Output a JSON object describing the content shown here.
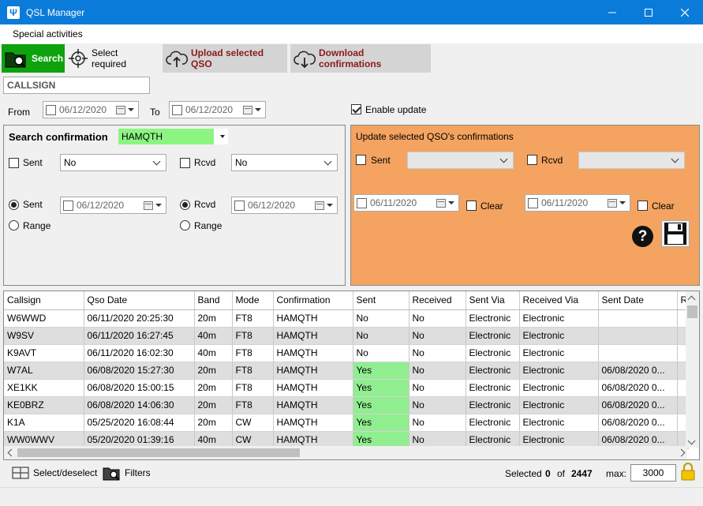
{
  "window": {
    "title": "QSL Manager",
    "app_icon": "antenna-icon"
  },
  "menu": {
    "items": [
      "Special activities"
    ]
  },
  "toolbar": {
    "search_label": "Search",
    "select_required_label": "Select required",
    "upload_label": "Upload selected QSO",
    "download_label": "Download confirmations"
  },
  "filters": {
    "callsign_value": "CALLSIGN",
    "from_label": "From",
    "from_date": "06/12/2020",
    "to_label": "To",
    "to_date": "06/12/2020",
    "enable_update_label": "Enable update",
    "enable_update_checked": true
  },
  "search_panel": {
    "title": "Search confirmation",
    "service": "HAMQTH",
    "sent_label": "Sent",
    "sent_value": "No",
    "rcvd_label": "Rcvd",
    "rcvd_value": "No",
    "sent_radio_label": "Sent",
    "sent_radio_date": "06/12/2020",
    "range_label": "Range",
    "rcvd_radio_label": "Rcvd",
    "rcvd_radio_date": "06/12/2020",
    "range2_label": "Range"
  },
  "update_panel": {
    "title": "Update selected QSO's confirmations",
    "sent_label": "Sent",
    "rcvd_label": "Rcvd",
    "sent_date": "06/11/2020",
    "clear_label": "Clear",
    "rcvd_date": "06/11/2020",
    "clear2_label": "Clear",
    "color": "#f4a460"
  },
  "grid": {
    "columns": [
      "Callsign",
      "Qso Date",
      "Band",
      "Mode",
      "Confirmation",
      "Sent",
      "Received",
      "Sent Via",
      "Received Via",
      "Sent Date",
      "R"
    ],
    "rows": [
      [
        "W6WWD",
        "06/11/2020 20:25:30",
        "20m",
        "FT8",
        "HAMQTH",
        "No",
        "No",
        "Electronic",
        "Electronic",
        "",
        ""
      ],
      [
        "W9SV",
        "06/11/2020 16:27:45",
        "40m",
        "FT8",
        "HAMQTH",
        "No",
        "No",
        "Electronic",
        "Electronic",
        "",
        ""
      ],
      [
        "K9AVT",
        "06/11/2020 16:02:30",
        "40m",
        "FT8",
        "HAMQTH",
        "No",
        "No",
        "Electronic",
        "Electronic",
        "",
        ""
      ],
      [
        "W7AL",
        "06/08/2020 15:27:30",
        "20m",
        "FT8",
        "HAMQTH",
        "Yes",
        "No",
        "Electronic",
        "Electronic",
        "06/08/2020 0...",
        ""
      ],
      [
        "XE1KK",
        "06/08/2020 15:00:15",
        "20m",
        "FT8",
        "HAMQTH",
        "Yes",
        "No",
        "Electronic",
        "Electronic",
        "06/08/2020 0...",
        ""
      ],
      [
        "KE0BRZ",
        "06/08/2020 14:06:30",
        "20m",
        "FT8",
        "HAMQTH",
        "Yes",
        "No",
        "Electronic",
        "Electronic",
        "06/08/2020 0...",
        ""
      ],
      [
        "K1A",
        "05/25/2020 16:08:44",
        "20m",
        "CW",
        "HAMQTH",
        "Yes",
        "No",
        "Electronic",
        "Electronic",
        "06/08/2020 0...",
        ""
      ],
      [
        "WW0WWV",
        "05/20/2020 01:39:16",
        "40m",
        "CW",
        "HAMQTH",
        "Yes",
        "No",
        "Electronic",
        "Electronic",
        "06/08/2020 0...",
        ""
      ]
    ]
  },
  "status": {
    "select_deselect_label": "Select/deselect",
    "filters_label": "Filters",
    "selected_label": "Selected",
    "selected_count": "0",
    "of_label": "of",
    "total_count": "2447",
    "max_label": "max:",
    "max_value": "3000"
  }
}
